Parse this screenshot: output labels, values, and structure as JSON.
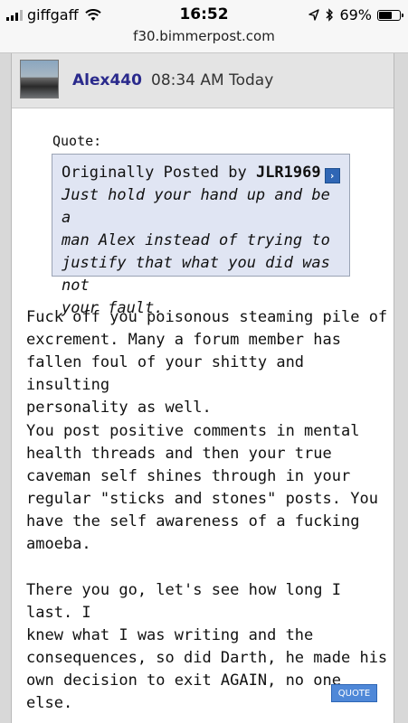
{
  "status_bar": {
    "carrier": "giffgaff",
    "time": "16:52",
    "battery_percent": "69%",
    "battery_level": 0.69,
    "url": "f30.bimmerpost.com",
    "icons": [
      "signal-icon",
      "wifi-icon",
      "location-arrow-icon",
      "bluetooth-icon",
      "battery-icon"
    ]
  },
  "post": {
    "username": "Alex440",
    "time": "08:34 AM Today",
    "quote": {
      "label": "Quote:",
      "originally_posted_by": "Originally Posted by",
      "author": "JLR1969",
      "lines": [
        "Just hold your hand up and be a",
        "man Alex instead of trying to",
        "justify that what you did was not",
        "your fault."
      ]
    },
    "paragraphs": [
      [
        "Fuck off you poisonous steaming pile of",
        "excrement. Many a forum member has",
        "fallen foul of your shitty and insulting",
        "personality as well."
      ],
      [
        "You post positive comments in mental",
        "health threads and then your true",
        "caveman self shines through in your",
        "regular \"sticks and stones\" posts. You",
        "have the self awareness of a fucking",
        "amoeba."
      ],
      [
        "There you go, let's see how long I last. I",
        "knew what I was writing and the",
        "consequences, so did Darth, he made his",
        "own decision to exit AGAIN, no one else."
      ]
    ],
    "quote_button": "QUOTE"
  },
  "colors": {
    "username": "#2a2a8c",
    "quote_bg": "#e0e5f3",
    "button": "#4f88d8"
  }
}
